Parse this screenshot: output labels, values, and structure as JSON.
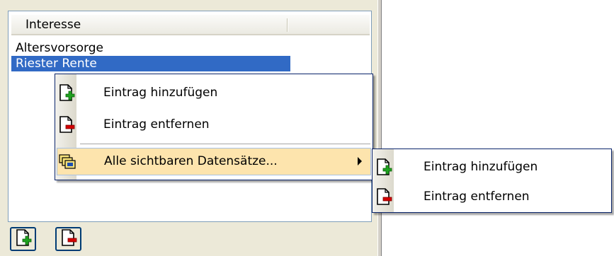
{
  "list": {
    "column_header": "Interesse",
    "rows": [
      "Altersvorsorge",
      "Riester Rente"
    ]
  },
  "context_menu": {
    "items": [
      {
        "label": "Eintrag hinzufügen",
        "icon": "document-add-icon"
      },
      {
        "label": "Eintrag entfernen",
        "icon": "document-remove-icon"
      },
      {
        "label": "Alle sichtbaren Datensätze...",
        "icon": "multiple-records-icon",
        "has_submenu": true,
        "highlighted": true
      }
    ]
  },
  "submenu": {
    "items": [
      {
        "label": "Eintrag hinzufügen",
        "icon": "document-add-icon"
      },
      {
        "label": "Eintrag entfernen",
        "icon": "document-remove-icon"
      }
    ]
  },
  "toolbar": {
    "buttons": [
      {
        "icon": "document-add-icon"
      },
      {
        "icon": "document-remove-icon"
      }
    ]
  },
  "colors": {
    "selection": "#316ac5",
    "menu_highlight": "#fde4ad",
    "menu_border": "#0a246a",
    "add_green": "#1fa21f",
    "remove_red": "#d40000"
  }
}
